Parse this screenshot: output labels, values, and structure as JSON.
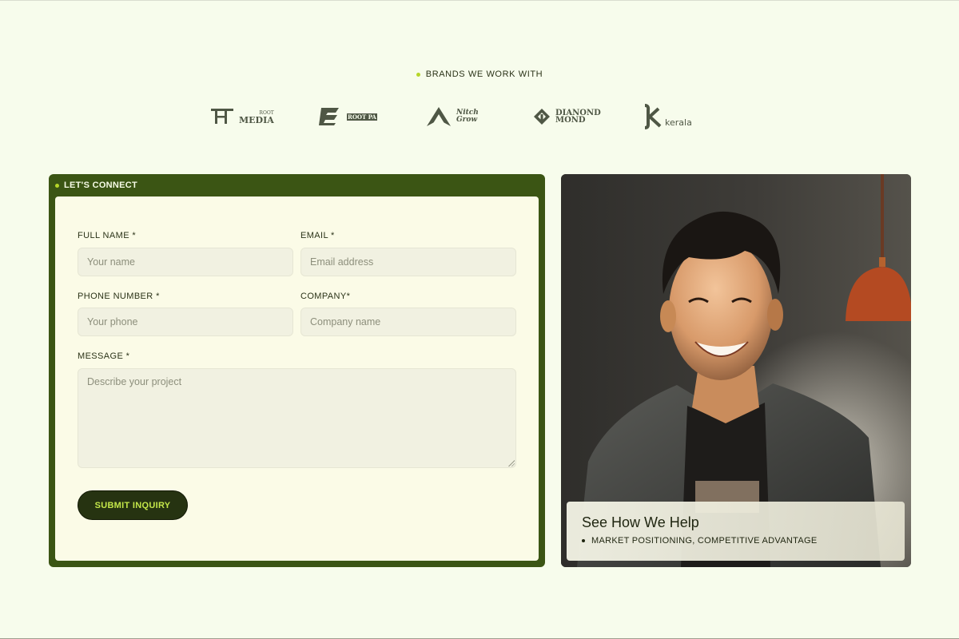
{
  "brands": {
    "heading": "BRANDS WE WORK WITH",
    "logos": [
      {
        "name": "root-media",
        "lines": [
          "ROOT",
          "MEDIA"
        ]
      },
      {
        "name": "root-pa",
        "lines": [
          "ROOT PA"
        ]
      },
      {
        "name": "nitch-grow",
        "lines": [
          "Nitch",
          "Grow"
        ]
      },
      {
        "name": "diamond-mond",
        "lines": [
          "DIANOND",
          "MOND"
        ]
      },
      {
        "name": "kerala",
        "lines": [
          "kerala"
        ]
      }
    ]
  },
  "contact": {
    "title": "LET'S CONNECT",
    "fields": {
      "full_name": {
        "label": "FULL NAME *",
        "placeholder": "Your name",
        "value": ""
      },
      "email": {
        "label": "EMAIL *",
        "placeholder": "Email address",
        "value": ""
      },
      "phone": {
        "label": "PHONE NUMBER *",
        "placeholder": "Your phone",
        "value": ""
      },
      "company": {
        "label": "COMPANY*",
        "placeholder": "Company name",
        "value": ""
      },
      "message": {
        "label": "MESSAGE *",
        "placeholder": "Describe your project",
        "value": ""
      }
    },
    "submit_label": "SUBMIT INQUIRY"
  },
  "feature": {
    "title": "See How We Help",
    "subtitle": "MARKET POSITIONING, COMPETITIVE ADVANTAGE"
  },
  "colors": {
    "background": "#f7fcec",
    "card_green": "#3b5514",
    "accent_lime": "#b6d629",
    "button_dark": "#263311",
    "button_text": "#c3e649"
  }
}
